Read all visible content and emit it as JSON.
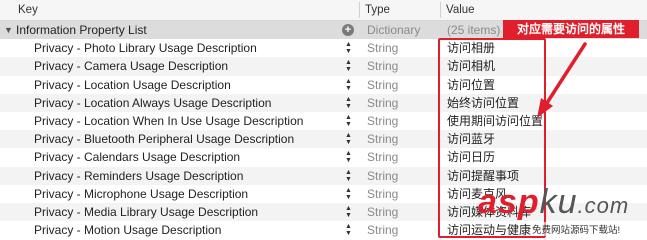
{
  "header": {
    "key": "Key",
    "type": "Type",
    "value": "Value"
  },
  "root": {
    "key": "Information Property List",
    "type": "Dictionary",
    "value": "(25 items)"
  },
  "rows": [
    {
      "key": "Privacy - Photo Library Usage Description",
      "type": "String",
      "value": "访问相册"
    },
    {
      "key": "Privacy - Camera Usage Description",
      "type": "String",
      "value": "访问相机"
    },
    {
      "key": "Privacy - Location Usage Description",
      "type": "String",
      "value": "访问位置"
    },
    {
      "key": "Privacy - Location Always Usage Description",
      "type": "String",
      "value": "始终访问位置"
    },
    {
      "key": "Privacy - Location When In Use Usage Description",
      "type": "String",
      "value": "使用期间访问位置"
    },
    {
      "key": "Privacy - Bluetooth Peripheral Usage Description",
      "type": "String",
      "value": "访问蓝牙"
    },
    {
      "key": "Privacy - Calendars Usage Description",
      "type": "String",
      "value": "访问日历"
    },
    {
      "key": "Privacy - Reminders Usage Description",
      "type": "String",
      "value": "访问提醒事项"
    },
    {
      "key": "Privacy - Microphone Usage Description",
      "type": "String",
      "value": "访问麦克风"
    },
    {
      "key": "Privacy - Media Library Usage Description",
      "type": "String",
      "value": "访问媒体资料库"
    },
    {
      "key": "Privacy - Motion Usage Description",
      "type": "String",
      "value": "访问运动与健康"
    }
  ],
  "annotation": {
    "label": "对应需要访问的属性",
    "color": "#e11e2b"
  },
  "watermark": {
    "brand_asp": "asp",
    "brand_ku": "ku",
    "brand_com": ".com",
    "tagline": "免费网站源码下载站!"
  },
  "icons": {
    "add": "plus-circle-icon",
    "disclosure": "triangle-down-icon",
    "stepper": "up-down-stepper-icon"
  }
}
